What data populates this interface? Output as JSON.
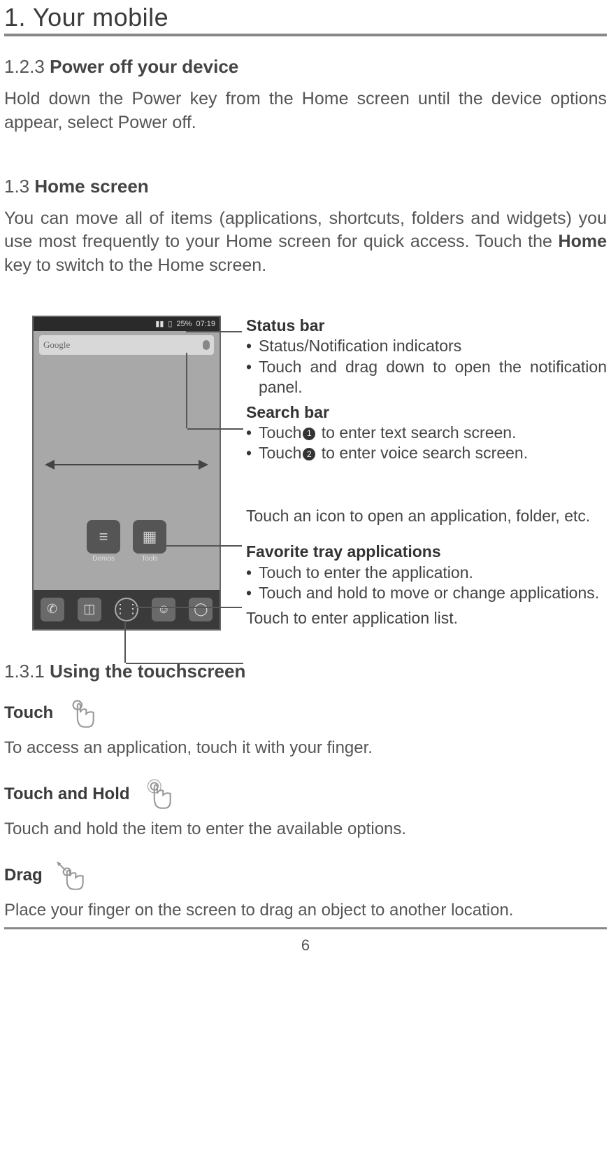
{
  "page": {
    "title": "1. Your mobile",
    "number": "6"
  },
  "sec_123": {
    "num": "1.2.3",
    "title": "Power off your device",
    "body": "Hold down the Power key from the Home screen until the device options appear, select Power off."
  },
  "sec_13": {
    "num": "1.3",
    "title": "Home screen",
    "body_pre": "You can move all of items (applications, shortcuts, folders and widgets) you use most frequently to your Home screen for quick access. Touch the ",
    "body_bold": "Home",
    "body_post": " key to switch to the Home screen."
  },
  "phone": {
    "status_battery": "25%",
    "status_time": "07:19",
    "search_placeholder": "Google",
    "mid_icon_1": "Demos",
    "mid_icon_2": "Tools"
  },
  "callouts": {
    "status_title": "Status bar",
    "status_b1": "Status/Notification indicators",
    "status_b2": "Touch and drag down to open the notification panel.",
    "search_title": "Search bar",
    "search_b1_pre": "Touch",
    "search_b1_post": " to enter text search screen.",
    "search_b2_pre": "Touch",
    "search_b2_post": " to enter voice search screen.",
    "icon_text": "Touch an icon to open an application, folder, etc.",
    "fav_title": "Favorite tray applications",
    "fav_b1": "Touch to enter the application.",
    "fav_b2": "Touch and hold to move or change applications.",
    "list_text": "Touch to enter application list."
  },
  "sec_131": {
    "num": "1.3.1",
    "title": "Using the touchscreen"
  },
  "gestures": {
    "touch_label": "Touch",
    "touch_desc": "To access an application, touch it with your finger.",
    "hold_label": "Touch and Hold",
    "hold_desc": "Touch and hold the item to enter the available options.",
    "drag_label": "Drag",
    "drag_desc": "Place your finger on the screen to drag an object to another location."
  }
}
